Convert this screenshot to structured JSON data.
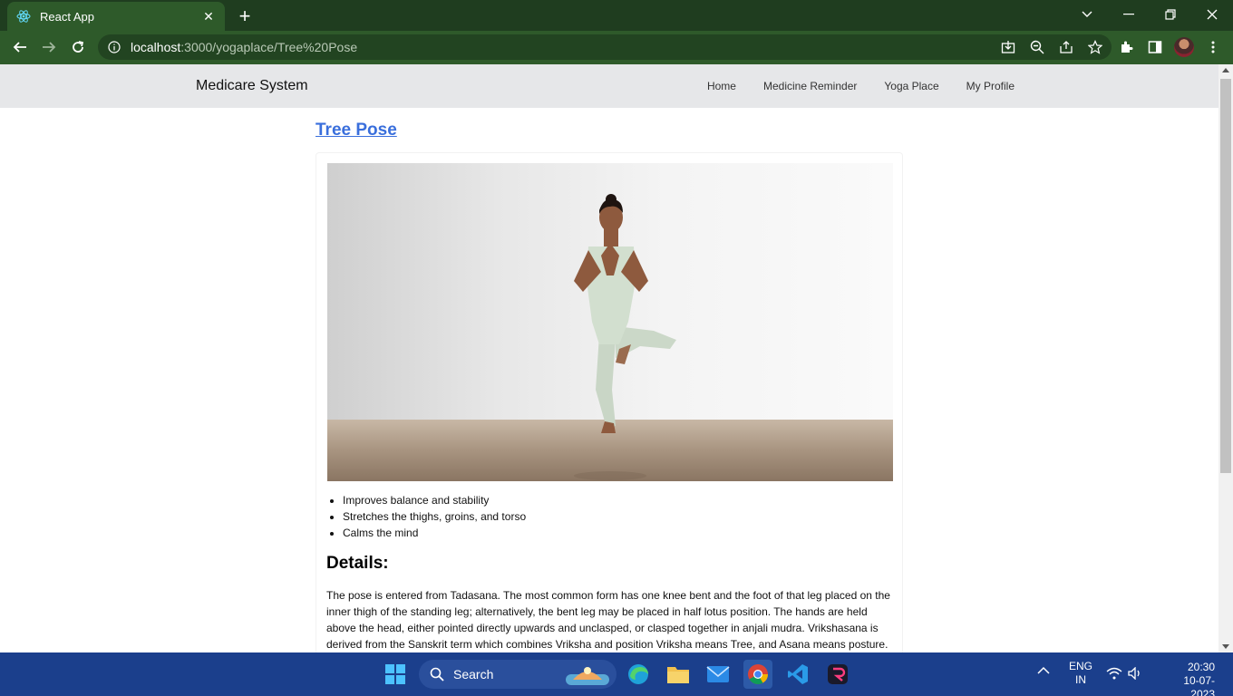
{
  "browser": {
    "tab_title": "React App",
    "url_host": "localhost",
    "url_path": ":3000/yogaplace/Tree%20Pose"
  },
  "app": {
    "brand": "Medicare System",
    "nav": [
      "Home",
      "Medicine Reminder",
      "Yoga Place",
      "My Profile"
    ]
  },
  "pose": {
    "title": "Tree Pose",
    "benefits": [
      "Improves balance and stability",
      "Stretches the thighs, groins, and torso",
      "Calms the mind"
    ],
    "details_heading": "Details:",
    "details_text": "The pose is entered from Tadasana. The most common form has one knee bent and the foot of that leg placed on the inner thigh of the standing leg; alternatively, the bent leg may be placed in half lotus position. The hands are held above the head, either pointed directly upwards and unclasped, or clasped together in anjali mudra. Vrikshasana is derived from the Sanskrit term which combines Vriksha and position Vriksha means Tree, and Asana means posture."
  },
  "taskbar": {
    "search_label": "Search",
    "lang_top": "ENG",
    "lang_bottom": "IN",
    "time": "20:30",
    "date": "10-07-2023"
  }
}
